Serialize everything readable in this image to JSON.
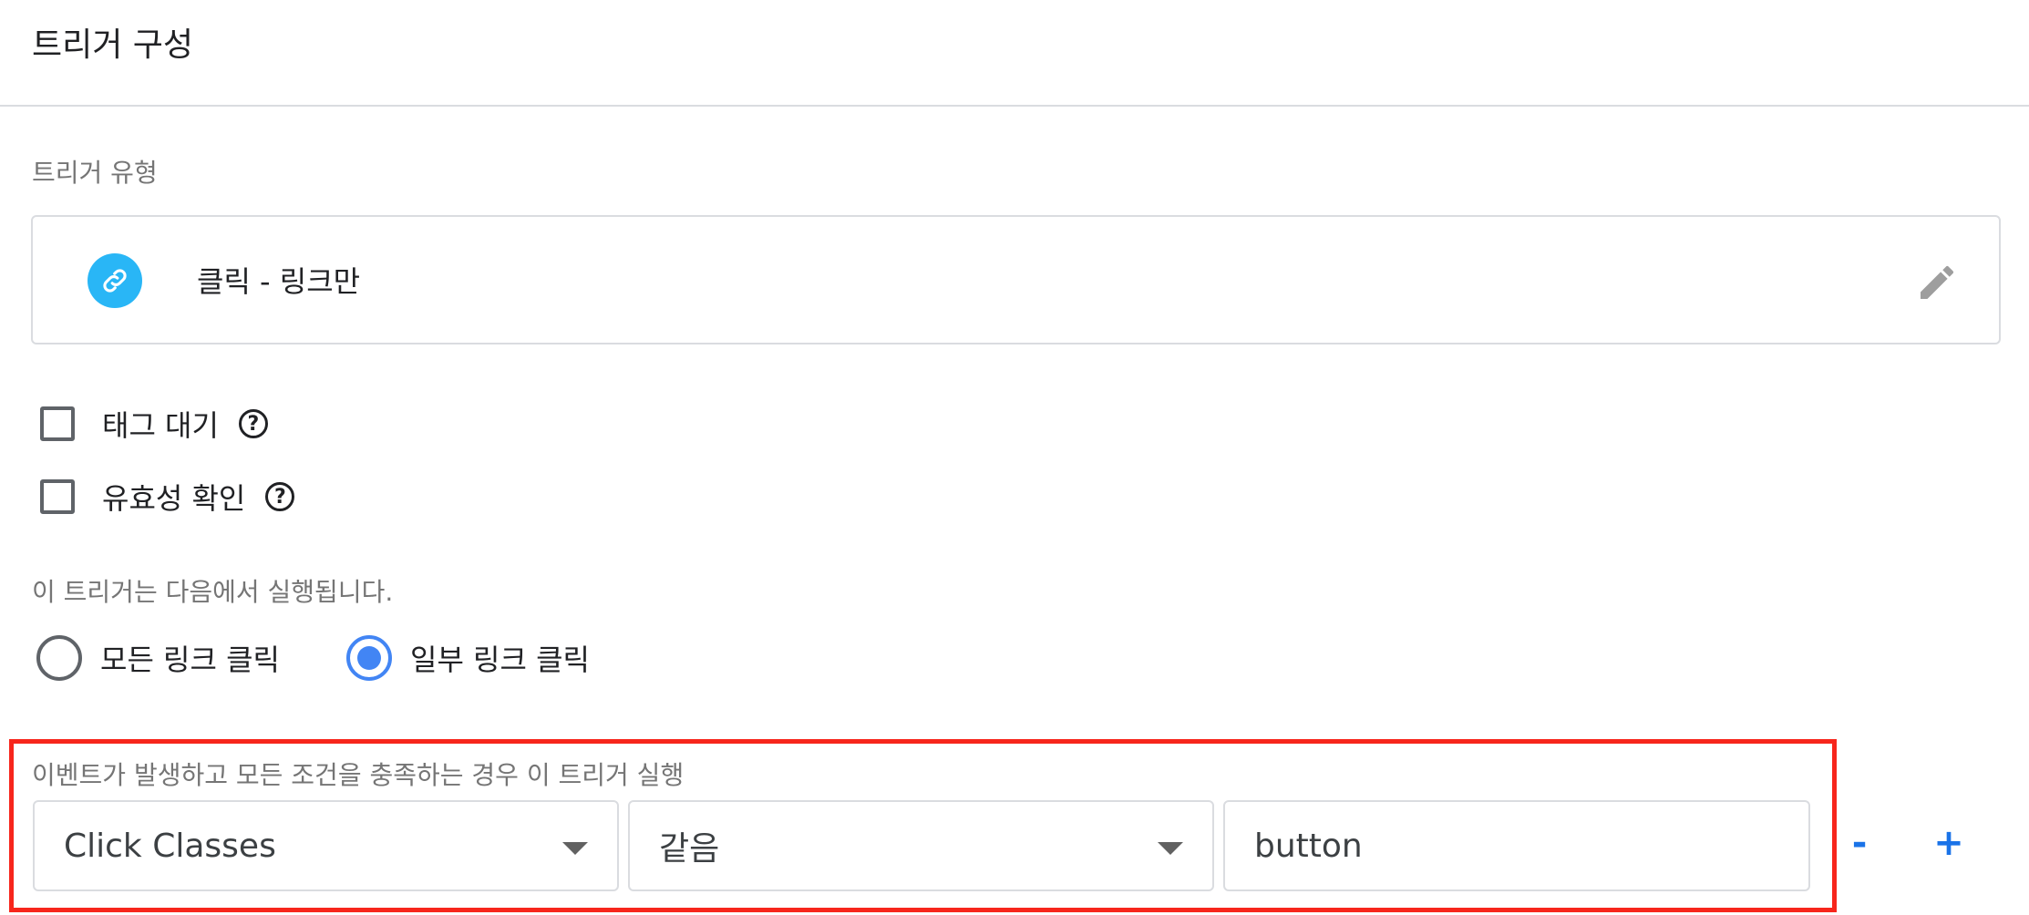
{
  "header": {
    "title": "트리거 구성"
  },
  "trigger_type": {
    "section_label": "트리거 유형",
    "name": "클릭 - 링크만",
    "icon": "link-icon",
    "icon_color": "#29b6f6"
  },
  "options": {
    "wait_for_tags": {
      "label": "태그 대기",
      "checked": false
    },
    "check_validation": {
      "label": "유효성 확인",
      "checked": false
    },
    "help_glyph": "?"
  },
  "fires_on": {
    "label": "이 트리거는 다음에서 실행됩니다.",
    "all_clicks": "모든 링크 클릭",
    "some_clicks": "일부 링크 클릭",
    "selected": "some_clicks"
  },
  "condition": {
    "label": "이벤트가 발생하고 모든 조건을 충족하는 경우 이 트리거 실행",
    "variable": "Click Classes",
    "operator": "같음",
    "value": "button",
    "remove_label": "-",
    "add_label": "+"
  },
  "colors": {
    "accent": "#4285f4",
    "link": "#1a73e8",
    "highlight": "#f7261c"
  }
}
